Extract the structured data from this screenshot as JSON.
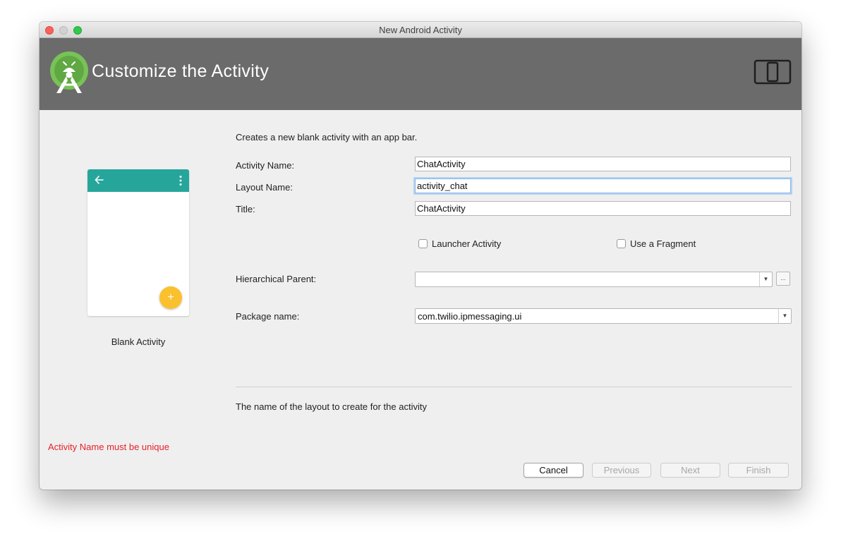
{
  "window": {
    "title": "New Android Activity"
  },
  "header": {
    "heading": "Customize the Activity",
    "logo_icon": "android-studio-logo-icon",
    "device_icon": "phone-tablet-icon",
    "background_color": "#6b6b6b"
  },
  "preview": {
    "label": "Blank Activity",
    "appbar_color": "#26a69a",
    "fab_color": "#fbc02d",
    "fab_symbol": "+",
    "back_icon": "arrow-left-icon",
    "menu_icon": "more-vert-icon"
  },
  "form": {
    "description": "Creates a new blank activity with an app bar.",
    "activity_name": {
      "label": "Activity Name:",
      "value": "ChatActivity"
    },
    "layout_name": {
      "label": "Layout Name:",
      "value": "activity_chat"
    },
    "title": {
      "label": "Title:",
      "value": "ChatActivity"
    },
    "launcher_activity": {
      "label": "Launcher Activity",
      "checked": false
    },
    "use_fragment": {
      "label": "Use a Fragment",
      "checked": false
    },
    "hierarchical_parent": {
      "label": "Hierarchical Parent:",
      "value": "",
      "browse_label": "..."
    },
    "package_name": {
      "label": "Package name:",
      "value": "com.twilio.ipmessaging.ui"
    }
  },
  "hint": "The name of the layout to create for the activity",
  "error": {
    "text": "Activity Name must be unique",
    "color": "#e8212b"
  },
  "buttons": {
    "cancel": "Cancel",
    "previous": "Previous",
    "next": "Next",
    "finish": "Finish"
  }
}
